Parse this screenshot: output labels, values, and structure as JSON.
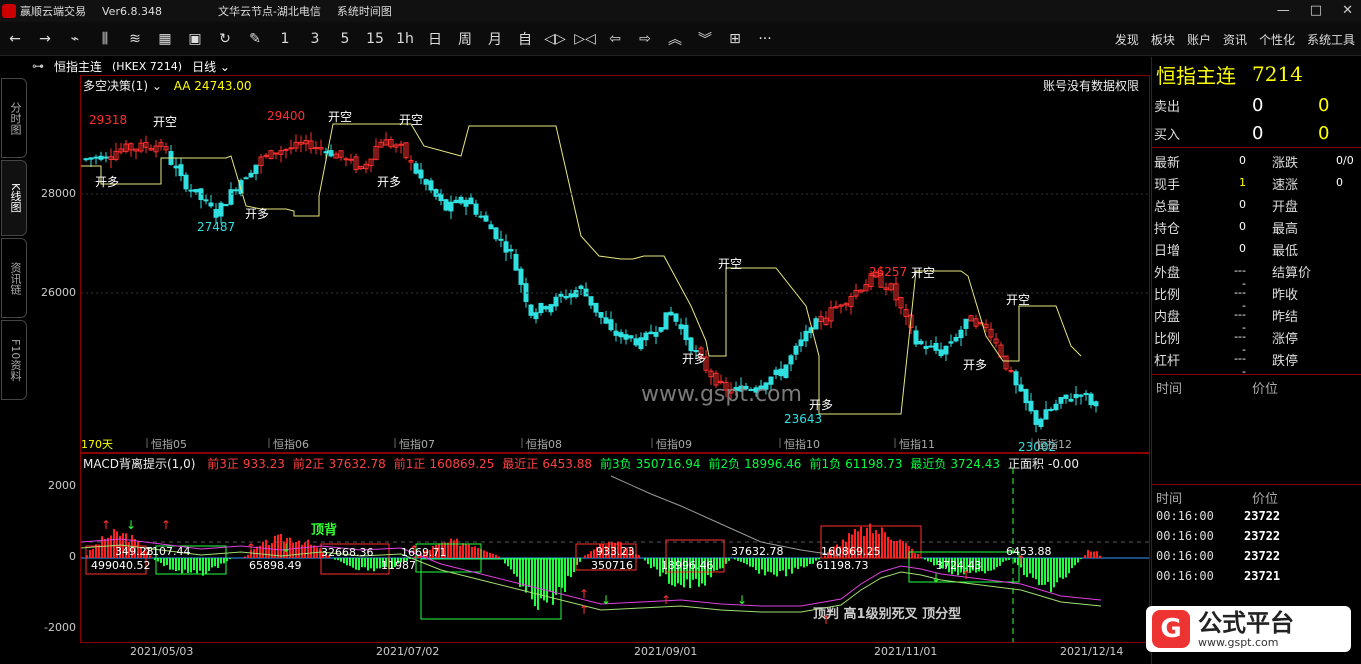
{
  "titlebar": {
    "app_title": "赢顺云端交易",
    "version": "Ver6.8.348",
    "node": "文华云节点-湖北电信",
    "system": "系统时间图",
    "min": "—",
    "max": "□",
    "close": "✕"
  },
  "toolbar": {
    "icons": [
      "back-icon",
      "forward-icon",
      "line-chart-icon",
      "candle-icon",
      "stack-icon",
      "grid-icon",
      "save-icon",
      "refresh-icon",
      "draw-icon"
    ],
    "periods": [
      "1",
      "3",
      "5",
      "15",
      "1h",
      "日",
      "周",
      "月",
      "自"
    ],
    "right_menu": [
      "发现",
      "板块",
      "账户",
      "资讯",
      "个性化",
      "系统工具"
    ]
  },
  "sidetabs": [
    "分时图",
    "K线图",
    "资讯链",
    "F10资料"
  ],
  "instrument": {
    "name": "恒指主连",
    "code": "(HKEX 7214)",
    "period": "日线"
  },
  "main": {
    "strategy": "多空决策(1)",
    "aa_label": "AA",
    "aa_value": "24743.00",
    "no_permission": "账号没有数据权限",
    "days_label": "170天",
    "y_ticks": [
      "28000",
      "26000"
    ],
    "x_ticks": [
      "恒指05",
      "恒指06",
      "恒指07",
      "恒指08",
      "恒指09",
      "恒指10",
      "恒指11",
      "恒指12"
    ],
    "annotations": {
      "hi1": "29318",
      "hi2": "29400",
      "hi3": "26257",
      "lo1": "27487",
      "lo2": "23643",
      "lo3": "23002",
      "open_short": "开空",
      "open_long": "开多"
    },
    "watermark": "www.gspt.com"
  },
  "macd": {
    "title": "MACD背离提示(1,0)",
    "items": [
      {
        "label": "前3正",
        "value": "933.23",
        "color": "r"
      },
      {
        "label": "前2正",
        "value": "37632.78",
        "color": "r"
      },
      {
        "label": "前1正",
        "value": "160869.25",
        "color": "r"
      },
      {
        "label": "最近正",
        "value": "6453.88",
        "color": "r"
      },
      {
        "label": "前3负",
        "value": "350716.94",
        "color": "g"
      },
      {
        "label": "前2负",
        "value": "18996.46",
        "color": "g"
      },
      {
        "label": "前1负",
        "value": "61198.73",
        "color": "g"
      },
      {
        "label": "最近负",
        "value": "3724.43",
        "color": "g"
      },
      {
        "label": "正面积",
        "value": "-0.00",
        "color": "w"
      }
    ],
    "y_ticks": [
      "2000",
      "0",
      "-2000"
    ],
    "bar_labels": [
      "349.28",
      "1107.44",
      "32668.36",
      "1669.71",
      "933.23",
      "37632.78",
      "160869.25",
      "6453.88",
      "499040.52",
      "65898.49",
      "11987",
      "350716",
      "18996.46",
      "61198.73",
      "3724.43"
    ],
    "signal_text": "顶判  高1级别死叉  顶分型",
    "bear_label": "顶背"
  },
  "dates": [
    "2021/05/03",
    "2021/07/02",
    "2021/09/01",
    "2021/11/01",
    "2021/12/14"
  ],
  "quote": {
    "title": "恒指主连",
    "code": "7214",
    "sell_label": "卖出",
    "sell_v1": "0",
    "sell_v2": "0",
    "buy_label": "买入",
    "buy_v1": "0",
    "buy_v2": "0",
    "rows": [
      {
        "l1": "最新",
        "v1": "0",
        "l2": "涨跌",
        "v2": "0/0"
      },
      {
        "l1": "现手",
        "v1": "1",
        "l2": "速涨",
        "v2": "0"
      },
      {
        "l1": "总量",
        "v1": "0",
        "l2": "开盘",
        "v2": ""
      },
      {
        "l1": "持仓",
        "v1": "0",
        "l2": "最高",
        "v2": ""
      },
      {
        "l1": "日增",
        "v1": "0",
        "l2": "最低",
        "v2": ""
      },
      {
        "l1": "外盘",
        "v1": "----",
        "l2": "结算价",
        "v2": ""
      },
      {
        "l1": "比例",
        "v1": "----",
        "l2": "昨收",
        "v2": ""
      },
      {
        "l1": "内盘",
        "v1": "----",
        "l2": "昨结",
        "v2": ""
      },
      {
        "l1": "比例",
        "v1": "----",
        "l2": "涨停",
        "v2": ""
      },
      {
        "l1": "杠杆",
        "v1": "----",
        "l2": "跌停",
        "v2": ""
      }
    ],
    "tick_hdr_time": "时间",
    "tick_hdr_price": "价位",
    "ticks": [
      {
        "t": "00:16:00",
        "p": "23722"
      },
      {
        "t": "00:16:00",
        "p": "23722"
      },
      {
        "t": "00:16:00",
        "p": "23722"
      },
      {
        "t": "00:16:00",
        "p": "23721"
      }
    ]
  },
  "logo": {
    "mark": "G",
    "name": "公式平台",
    "url": "www.gspt.com"
  }
}
